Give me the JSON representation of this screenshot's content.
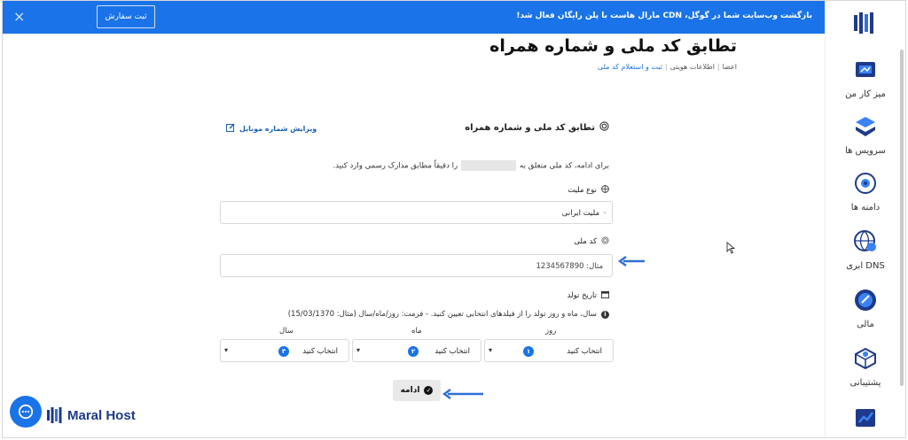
{
  "banner": {
    "text": "بازگشت وب‌سایت شما در گوگل، CDN مارال هاست با پلن رایگان فعال شد!",
    "order_button": "ثبت سفارش",
    "close_icon": "×"
  },
  "sidebar": {
    "items": [
      {
        "label": "میز کار من",
        "icon": "desk-icon"
      },
      {
        "label": "سرویس ها",
        "icon": "layers-icon"
      },
      {
        "label": "دامنه ها",
        "icon": "domain-icon"
      },
      {
        "label": "DNS ابری",
        "icon": "globe-icon"
      },
      {
        "label": "مالی",
        "icon": "finance-icon"
      },
      {
        "label": "پشتیبانی",
        "icon": "support-icon"
      }
    ]
  },
  "page": {
    "title": "تطابق کد ملی و شماره همراه",
    "breadcrumb": [
      "اعضا",
      "اطلاعات هویتی",
      "ثبت و استعلام کد ملی"
    ]
  },
  "form": {
    "card_title": "تطابق کد ملی و شماره همراه",
    "edit_mobile": "ویرایش شماره موبایل",
    "intro_before": "برای ادامه، کد ملی متعلق به",
    "intro_after": "را دقیقاً مطابق مدارک رسمی وارد کنید.",
    "nationality_label": "نوع ملیت",
    "nationality_value": "ملیت ایرانی",
    "national_code_label": "کد ملی",
    "national_code_placeholder": "مثال: 1234567890",
    "birth_date_label": "تاریخ تولد",
    "birth_info": "سال، ماه و روز تولد را از فیلدهای انتخابی تعیین کنید. - فرمت: روز/ماه/سال (مثال: 15/03/1370)",
    "day_label": "روز",
    "month_label": "ماه",
    "year_label": "سال",
    "select_placeholder": "انتخاب کنید",
    "badges": [
      "۱",
      "۲",
      "۳"
    ],
    "submit": "ادامه"
  },
  "brand": {
    "name": "Maral Host"
  },
  "colors": {
    "accent": "#1a73e8",
    "arrow": "#2f6fd6"
  }
}
